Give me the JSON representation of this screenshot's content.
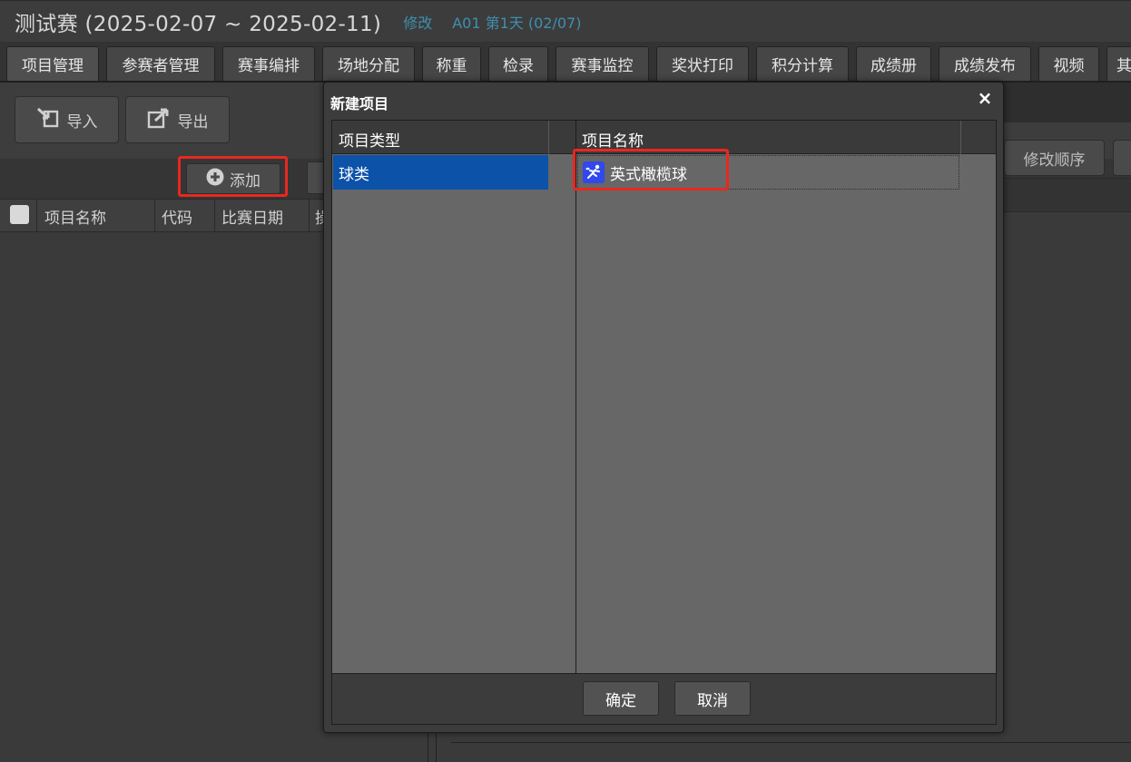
{
  "titlebar": {
    "title": "测试赛 (2025-02-07 ~ 2025-02-11)",
    "edit_link": "修改",
    "day_info": "A01 第1天 (02/07)"
  },
  "tabs": [
    {
      "label": "项目管理",
      "active": true
    },
    {
      "label": "参赛者管理"
    },
    {
      "label": "赛事编排"
    },
    {
      "label": "场地分配"
    },
    {
      "label": "称重"
    },
    {
      "label": "检录"
    },
    {
      "label": "赛事监控"
    },
    {
      "label": "奖状打印"
    },
    {
      "label": "积分计算"
    },
    {
      "label": "成绩册"
    },
    {
      "label": "成绩发布"
    },
    {
      "label": "视频"
    },
    {
      "label": "其"
    }
  ],
  "toolbar": {
    "import_label": "导入",
    "export_label": "导出",
    "add_label": "添加",
    "reorder_label": "修改顺序"
  },
  "left_table": {
    "columns": [
      "项目名称",
      "代码",
      "比赛日期",
      "操"
    ]
  },
  "modal": {
    "title": "新建项目",
    "close": "×",
    "col_type": "项目类型",
    "col_name": "项目名称",
    "types": [
      "球类"
    ],
    "names": [
      "英式橄榄球"
    ],
    "ok_label": "确定",
    "cancel_label": "取消"
  },
  "colors": {
    "selection": "#0b52a8",
    "highlight": "#e8281f",
    "accent_link": "#3f8fb0"
  },
  "icons": {
    "import": "import-icon",
    "export": "export-icon",
    "add": "plus-circle-icon",
    "sport": "rugby-player-icon"
  }
}
